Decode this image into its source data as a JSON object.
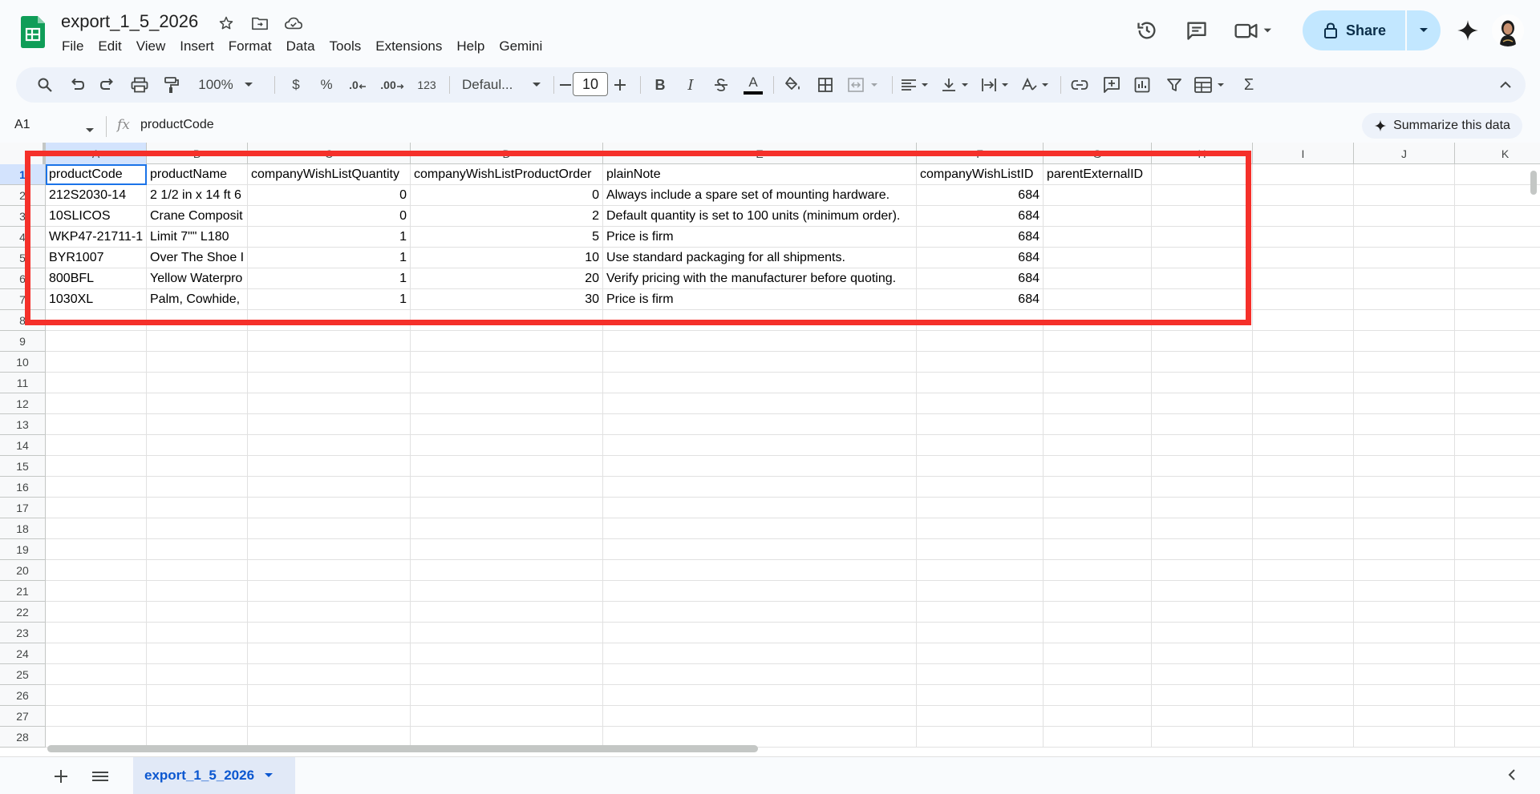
{
  "app": {
    "doc_title": "export_1_5_2026",
    "menu": [
      "File",
      "Edit",
      "View",
      "Insert",
      "Format",
      "Data",
      "Tools",
      "Extensions",
      "Help",
      "Gemini"
    ],
    "share_label": "Share"
  },
  "toolbar": {
    "zoom": "100%",
    "currency": "$",
    "percent": "%",
    "dec_decrease": ".0",
    "dec_increase": ".00",
    "number_format": "123",
    "font": "Defaul...",
    "font_size": "10",
    "bold": "B",
    "italic": "I",
    "text_color_letter": "A",
    "sigma": "Σ"
  },
  "formula_bar": {
    "cell_ref": "A1",
    "fx": "fx",
    "content": "productCode",
    "summarize": "Summarize this data"
  },
  "grid": {
    "column_letters": [
      "A",
      "B",
      "C",
      "D",
      "E",
      "F",
      "G",
      "H",
      "I",
      "J",
      "K"
    ],
    "row_numbers": [
      "1",
      "2",
      "3",
      "4",
      "5",
      "6",
      "7",
      "8",
      "9",
      "10",
      "11",
      "12",
      "13",
      "14",
      "15",
      "16",
      "17",
      "18",
      "19",
      "20",
      "21",
      "22",
      "23",
      "24",
      "25",
      "26",
      "27",
      "28"
    ],
    "headers": [
      "productCode",
      "productName",
      "companyWishListQuantity",
      "companyWishListProductOrder",
      "plainNote",
      "companyWishListID",
      "parentExternalID"
    ],
    "rows": [
      [
        "212S2030-14",
        "2 1/2 in x 14 ft 6",
        "0",
        "0",
        "Always include a spare set of mounting hardware.",
        "684",
        ""
      ],
      [
        "10SLICOS",
        "Crane Composit",
        "0",
        "2",
        "Default quantity is set to 100 units (minimum order).",
        "684",
        ""
      ],
      [
        "WKP47-21711-1",
        "Limit 7\"\" L180",
        "1",
        "5",
        "Price is firm",
        "684",
        ""
      ],
      [
        "BYR1007",
        "Over The Shoe I",
        "1",
        "10",
        "Use standard packaging for all shipments.",
        "684",
        ""
      ],
      [
        "800BFL",
        "Yellow Waterpro",
        "1",
        "20",
        "Verify pricing with the manufacturer before quoting.",
        "684",
        ""
      ],
      [
        "1030XL",
        "Palm, Cowhide,",
        "1",
        "30",
        "Price is firm",
        "684",
        ""
      ]
    ]
  },
  "sheets": {
    "tabs": [
      "export_1_5_2026"
    ]
  },
  "colors": {
    "accent": "#0b57d0",
    "share_bg": "#c2e7ff",
    "highlight_box": "#f5302a",
    "sheets_green": "#0f9d58"
  }
}
